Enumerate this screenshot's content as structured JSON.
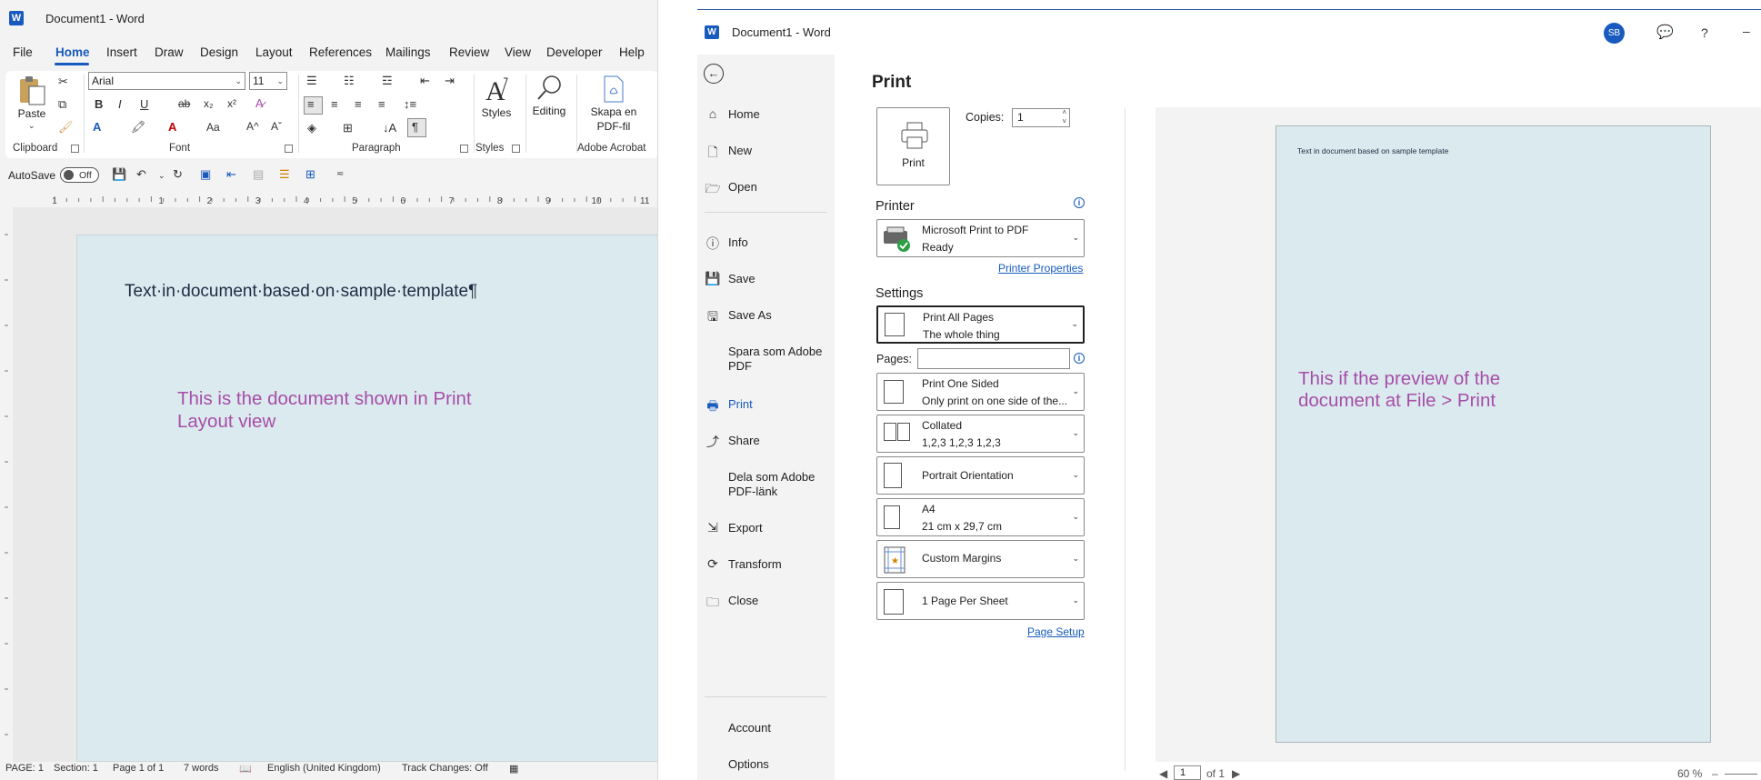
{
  "left_window": {
    "title": "Document1  -  Word",
    "app_logo": "W",
    "menu_tabs": [
      "File",
      "Home",
      "Insert",
      "Draw",
      "Design",
      "Layout",
      "References",
      "Mailings",
      "Review",
      "View",
      "Developer",
      "Help"
    ],
    "active_tab": "Home",
    "ribbon": {
      "paste_label": "Paste",
      "font_name": "Arial",
      "font_size": "11",
      "styles_label": "Styles",
      "editing_label": "Editing",
      "adobe_label_1": "Skapa en",
      "adobe_label_2": "PDF-fil",
      "group_labels": {
        "clipboard": "Clipboard",
        "font": "Font",
        "paragraph": "Paragraph",
        "styles": "Styles",
        "adobe": "Adobe Acrobat"
      }
    },
    "qat": {
      "autosave_label": "AutoSave",
      "autosave_state": "Off"
    },
    "ruler_numbers": [
      "1",
      "1",
      "2",
      "3",
      "4",
      "5",
      "6",
      "7",
      "8",
      "9",
      "10",
      "11"
    ],
    "document_text": "Text·in·document·based·on·sample·template¶",
    "annotation_lines": [
      "This is the document shown in Print",
      "Layout view"
    ],
    "status": {
      "page": "PAGE: 1",
      "section": "Section: 1",
      "page_of": "Page 1 of 1",
      "words": "7 words",
      "language": "English (United Kingdom)",
      "track_changes": "Track Changes: Off"
    }
  },
  "right_window": {
    "title": "Document1  -  Word",
    "app_logo": "W",
    "user_initials": "SB",
    "help_icon_text": "?",
    "minimize_text": "–",
    "nav": [
      {
        "label": "Home",
        "icon": "home-icon"
      },
      {
        "label": "New",
        "icon": "new-document-icon"
      },
      {
        "label": "Open",
        "icon": "folder-open-icon"
      },
      {
        "label": "Info",
        "icon": "info-icon"
      },
      {
        "label": "Save",
        "icon": "save-icon"
      },
      {
        "label": "Save As",
        "icon": "save-as-icon"
      },
      {
        "label": "Spara som Adobe PDF",
        "icon": ""
      },
      {
        "label": "Print",
        "icon": "printer-icon"
      },
      {
        "label": "Share",
        "icon": "share-icon"
      },
      {
        "label": "Dela som Adobe PDF-länk",
        "icon": ""
      },
      {
        "label": "Export",
        "icon": "export-icon"
      },
      {
        "label": "Transform",
        "icon": "transform-icon"
      },
      {
        "label": "Close",
        "icon": "close-folder-icon"
      },
      {
        "label": "Account",
        "icon": ""
      },
      {
        "label": "Options",
        "icon": ""
      }
    ],
    "nav_split": {
      "spara_1": "Spara som Adobe",
      "spara_2": "PDF",
      "dela_1": "Dela som Adobe",
      "dela_2": "PDF-länk"
    },
    "active_nav": "Print",
    "print": {
      "heading": "Print",
      "print_button_label": "Print",
      "copies_label": "Copies:",
      "copies_value": "1",
      "printer_heading": "Printer",
      "printer_name": "Microsoft Print to PDF",
      "printer_status": "Ready",
      "printer_properties_link": "Printer Properties",
      "settings_heading": "Settings",
      "pages_label": "Pages:",
      "pages_value": "",
      "settings": [
        {
          "main": "Print All Pages",
          "sub": "The whole thing"
        },
        {
          "main": "Print One Sided",
          "sub": "Only print on one side of the..."
        },
        {
          "main": "Collated",
          "sub": "1,2,3    1,2,3    1,2,3"
        },
        {
          "main": "Portrait Orientation",
          "sub": ""
        },
        {
          "main": "A4",
          "sub": "21 cm x 29,7 cm"
        },
        {
          "main": "Custom Margins",
          "sub": ""
        },
        {
          "main": "1 Page Per Sheet",
          "sub": ""
        }
      ],
      "page_setup_link": "Page Setup"
    },
    "preview": {
      "page_text": "Text in document based on sample template",
      "annotation_lines": [
        "This if the preview of the",
        "document at File > Print"
      ],
      "current_page": "1",
      "of_pages": "of 1",
      "zoom": "60 %"
    }
  },
  "colors": {
    "word_blue": "#185abd",
    "page_tint": "#dbeaee",
    "annotation_purple": "#a74ea8"
  }
}
